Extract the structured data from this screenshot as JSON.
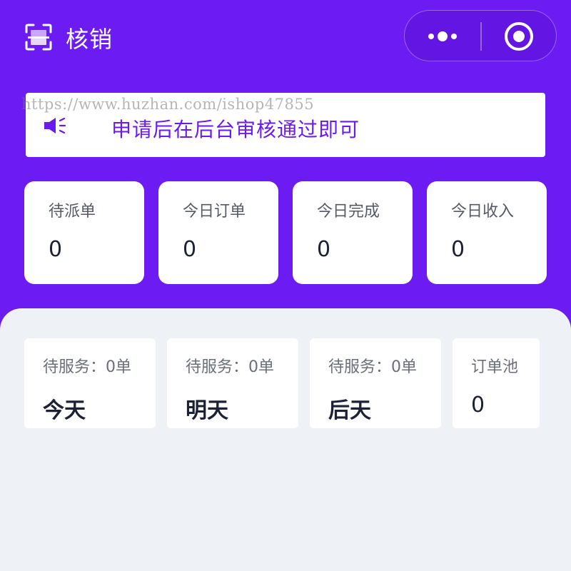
{
  "header": {
    "title": "核销",
    "more_dots": "•••"
  },
  "notice": {
    "text": "申请后在后台审核通过即可",
    "watermark": "https://www.huzhan.com/ishop47855"
  },
  "stats": [
    {
      "label": "待派单",
      "value": "0"
    },
    {
      "label": "今日订单",
      "value": "0"
    },
    {
      "label": "今日完成",
      "value": "0"
    },
    {
      "label": "今日收入",
      "value": "0"
    }
  ],
  "days": [
    {
      "sub": "待服务：0单",
      "main": "今天"
    },
    {
      "sub": "待服务：0单",
      "main": "明天"
    },
    {
      "sub": "待服务：0单",
      "main": "后天"
    }
  ],
  "pool": {
    "label": "订单池",
    "value": "0"
  },
  "colors": {
    "primary": "#6c1cf2",
    "notice_text": "#6a1bf0",
    "panel_bg": "#eef1f5",
    "card_bg": "#ffffff",
    "value_text": "#1c2233"
  },
  "icons": {
    "scan": "scan-icon",
    "speaker": "speaker-icon",
    "more": "more-dots-icon",
    "close": "close-circle-icon"
  }
}
